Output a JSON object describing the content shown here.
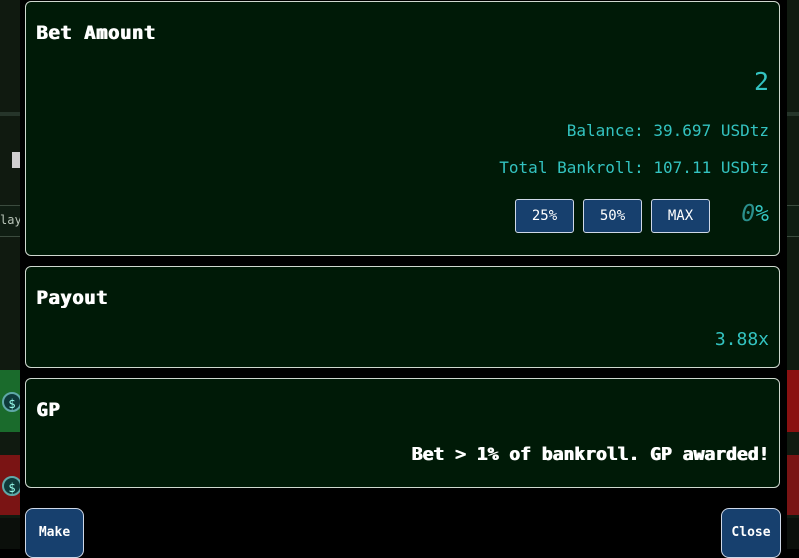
{
  "background": {
    "left_snippet": "lay",
    "coin_icon": "dollar-coin-icon"
  },
  "bet_amount": {
    "title": "Bet Amount",
    "value": "2",
    "balance": "Balance: 39.697 USDtz",
    "bankroll": "Total Bankroll: 107.11 USDtz",
    "buttons": [
      "25%",
      "50%",
      "MAX"
    ],
    "percent_value": "0",
    "percent_sign": "%"
  },
  "payout": {
    "title": "Payout",
    "value": "3.88x"
  },
  "gp": {
    "title": "GP",
    "message": "Bet > 1% of bankroll. GP awarded!"
  },
  "footer": {
    "make_label": "Make",
    "close_label": "Close"
  },
  "colors": {
    "panel_bg": "#001a07",
    "accent_teal": "#33c3c0",
    "button_blue": "#17406e"
  }
}
